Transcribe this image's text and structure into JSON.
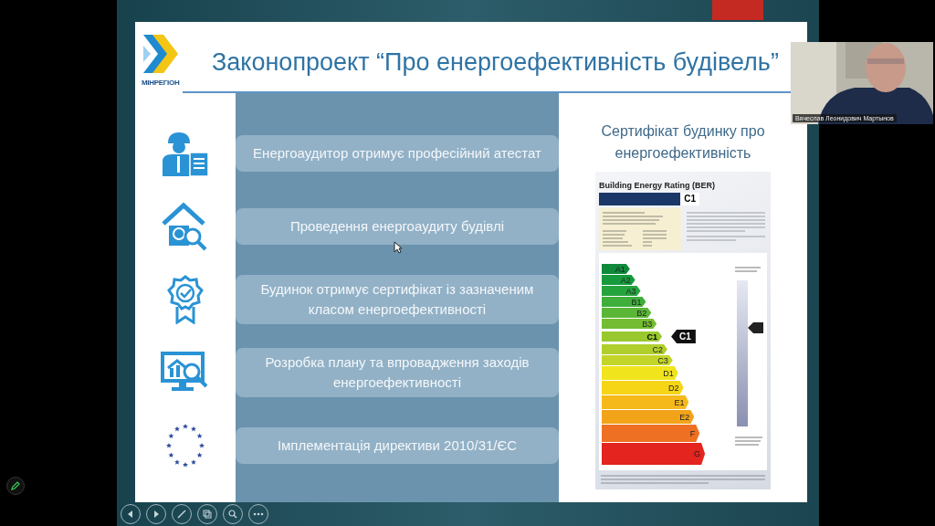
{
  "slide": {
    "logo_text": "МІНРЕГІОН",
    "title": "Законопроект “Про енергоефективність будівель”",
    "steps": [
      {
        "kind": "auditor",
        "text": "Енергоаудитор отримує професійний атестат"
      },
      {
        "kind": "house",
        "text": "Проведення енергоаудиту будівлі"
      },
      {
        "kind": "badge",
        "text": "Будинок отримує сертифікат із зазначеним класом енергоефективності"
      },
      {
        "kind": "monitor",
        "text": "Розробка плану та впровадження заходів енергоефективності"
      },
      {
        "kind": "stars",
        "text": "Імплементація директиви 2010/31/ЄС"
      }
    ],
    "certificate": {
      "heading": "Сертифікат будинку про енергоефективність",
      "label_title": "Building Energy Rating (BER)",
      "rating_box": "C1",
      "pointer_label": "C1",
      "bands": [
        {
          "label": "A1",
          "color": "#0e8a3a",
          "selected": false
        },
        {
          "label": "A2",
          "color": "#179a3e",
          "selected": false
        },
        {
          "label": "A3",
          "color": "#25a43e",
          "selected": false
        },
        {
          "label": "B1",
          "color": "#3fae3a",
          "selected": false
        },
        {
          "label": "B2",
          "color": "#5ab636",
          "selected": false
        },
        {
          "label": "B3",
          "color": "#74bd32",
          "selected": false
        },
        {
          "label": "C1",
          "color": "#98c82e",
          "selected": true
        },
        {
          "label": "C2",
          "color": "#b0cf2c",
          "selected": false
        },
        {
          "label": "C3",
          "color": "#c4d52a",
          "selected": false
        },
        {
          "label": "D1",
          "color": "#f0e41c",
          "selected": false
        },
        {
          "label": "D2",
          "color": "#f5d516",
          "selected": false
        },
        {
          "label": "E1",
          "color": "#f6b91a",
          "selected": false
        },
        {
          "label": "E2",
          "color": "#f3a31a",
          "selected": false
        },
        {
          "label": "F",
          "color": "#ee7123",
          "selected": false
        },
        {
          "label": "G",
          "color": "#e3241f",
          "selected": false
        }
      ]
    }
  },
  "presenter": {
    "name": "Вячеслав Леонидович Мартынов"
  },
  "toolbar": [
    {
      "kind": "previous"
    },
    {
      "kind": "next"
    },
    {
      "kind": "pen"
    },
    {
      "kind": "slides"
    },
    {
      "kind": "zoom"
    },
    {
      "kind": "more"
    }
  ]
}
